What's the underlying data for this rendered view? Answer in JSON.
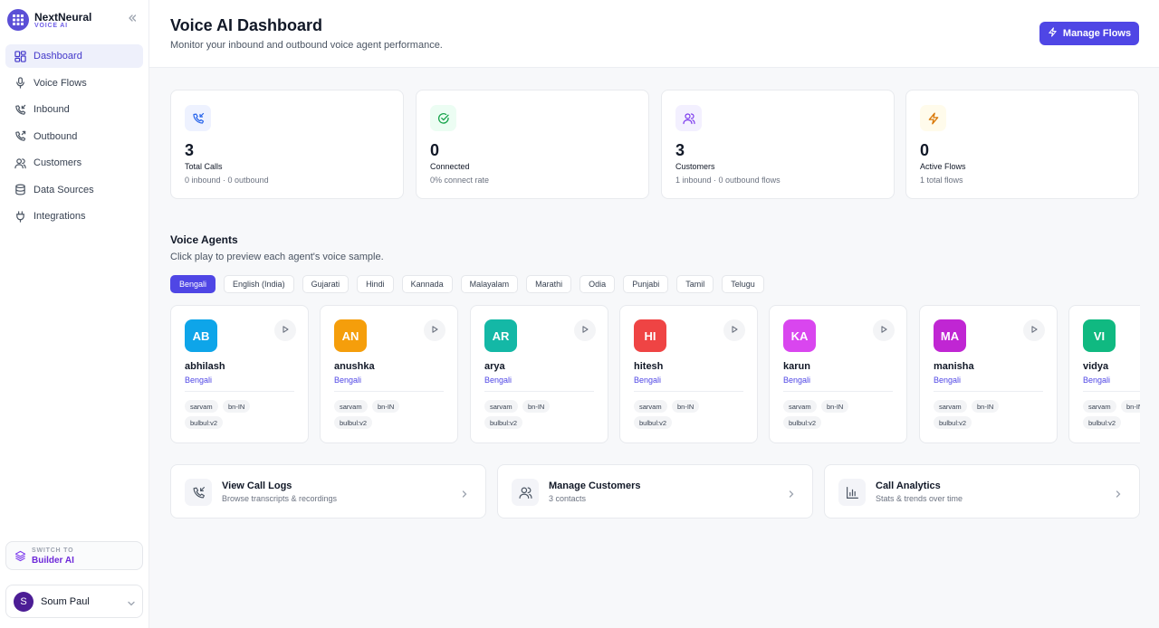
{
  "brand": {
    "name": "NextNeural",
    "subtitle": "VOICE AI"
  },
  "sidebar": {
    "items": [
      {
        "label": "Dashboard",
        "icon": "dashboard-icon",
        "active": true
      },
      {
        "label": "Voice Flows",
        "icon": "microphone-icon"
      },
      {
        "label": "Inbound",
        "icon": "phone-incoming-icon"
      },
      {
        "label": "Outbound",
        "icon": "phone-outgoing-icon"
      },
      {
        "label": "Customers",
        "icon": "users-icon"
      },
      {
        "label": "Data Sources",
        "icon": "database-icon"
      },
      {
        "label": "Integrations",
        "icon": "plug-icon"
      }
    ],
    "switch": {
      "top": "SWITCH TO",
      "bottom": "Builder AI"
    },
    "user": {
      "initial": "S",
      "name": "Soum Paul"
    }
  },
  "header": {
    "title": "Voice AI Dashboard",
    "subtitle": "Monitor your inbound and outbound voice agent performance.",
    "button": "Manage Flows"
  },
  "stats": [
    {
      "value": "3",
      "label": "Total Calls",
      "sub": "0 inbound · 0 outbound",
      "color": "#2563eb",
      "bg": "#eef2ff"
    },
    {
      "value": "0",
      "label": "Connected",
      "sub": "0% connect rate",
      "color": "#16a34a",
      "bg": "#ecfdf3"
    },
    {
      "value": "3",
      "label": "Customers",
      "sub": "1 inbound · 0 outbound flows",
      "color": "#7c3aed",
      "bg": "#f3f0ff"
    },
    {
      "value": "0",
      "label": "Active Flows",
      "sub": "1 total flows",
      "color": "#d97706",
      "bg": "#fffbeb"
    }
  ],
  "agents_section": {
    "title": "Voice Agents",
    "subtitle": "Click play to preview each agent's voice sample.",
    "languages": [
      "Bengali",
      "English (India)",
      "Gujarati",
      "Hindi",
      "Kannada",
      "Malayalam",
      "Marathi",
      "Odia",
      "Punjabi",
      "Tamil",
      "Telugu"
    ],
    "active_language": "Bengali",
    "agents": [
      {
        "initials": "AB",
        "name": "abhilash",
        "lang": "Bengali",
        "tags": [
          "sarvam",
          "bn-IN",
          "bulbul:v2"
        ],
        "color": "#0ea5e9"
      },
      {
        "initials": "AN",
        "name": "anushka",
        "lang": "Bengali",
        "tags": [
          "sarvam",
          "bn-IN",
          "bulbul:v2"
        ],
        "color": "#f59e0b"
      },
      {
        "initials": "AR",
        "name": "arya",
        "lang": "Bengali",
        "tags": [
          "sarvam",
          "bn-IN",
          "bulbul:v2"
        ],
        "color": "#14b8a6"
      },
      {
        "initials": "HI",
        "name": "hitesh",
        "lang": "Bengali",
        "tags": [
          "sarvam",
          "bn-IN",
          "bulbul:v2"
        ],
        "color": "#ef4444"
      },
      {
        "initials": "KA",
        "name": "karun",
        "lang": "Bengali",
        "tags": [
          "sarvam",
          "bn-IN",
          "bulbul:v2"
        ],
        "color": "#d946ef"
      },
      {
        "initials": "MA",
        "name": "manisha",
        "lang": "Bengali",
        "tags": [
          "sarvam",
          "bn-IN",
          "bulbul:v2"
        ],
        "color": "#c026d3"
      },
      {
        "initials": "VI",
        "name": "vidya",
        "lang": "Bengali",
        "tags": [
          "sarvam",
          "bn-IN",
          "bulbul:v2"
        ],
        "color": "#10b981"
      }
    ]
  },
  "links": [
    {
      "title": "View Call Logs",
      "sub": "Browse transcripts & recordings",
      "icon": "phone-incoming-icon"
    },
    {
      "title": "Manage Customers",
      "sub": "3 contacts",
      "icon": "users-icon"
    },
    {
      "title": "Call Analytics",
      "sub": "Stats & trends over time",
      "icon": "bar-chart-icon"
    }
  ]
}
